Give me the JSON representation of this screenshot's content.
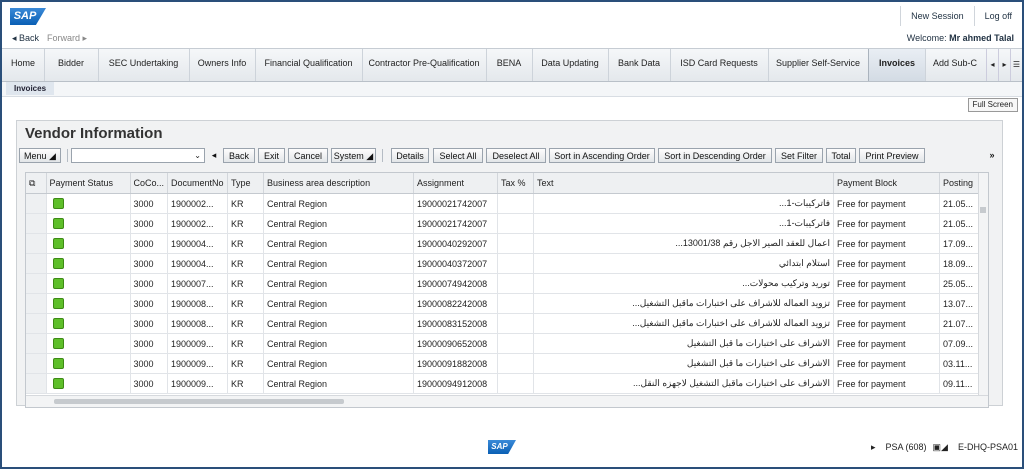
{
  "header": {
    "logo": "SAP",
    "new_session": "New Session",
    "log_off": "Log off"
  },
  "nav": {
    "back": "◂ Back",
    "forward": "Forward ▸",
    "welcome": "Welcome:",
    "user": "Mr ahmed Talal"
  },
  "tabs": [
    "Home",
    "Bidder",
    "SEC Undertaking",
    "Owners Info",
    "Financial Qualification",
    "Contractor Pre-Qualification",
    "BENA",
    "Data Updating",
    "Bank Data",
    "ISD Card Requests",
    "Supplier Self-Service",
    "Invoices",
    "Add Sub-C"
  ],
  "subtab": "Invoices",
  "full_screen": "Full Screen",
  "panel_title": "Vendor Information",
  "toolbar": {
    "menu": "Menu",
    "back": "Back",
    "exit": "Exit",
    "cancel": "Cancel",
    "system": "System",
    "details": "Details",
    "select_all": "Select All",
    "deselect_all": "Deselect All",
    "sort_asc": "Sort in Ascending Order",
    "sort_desc": "Sort in Descending Order",
    "set_filter": "Set Filter",
    "total": "Total",
    "print_preview": "Print Preview",
    "more": "»"
  },
  "table": {
    "columns": [
      "Payment Status",
      "CoCo...",
      "DocumentNo",
      "Type",
      "Business area description",
      "Assignment",
      "Tax %",
      "Text",
      "Payment Block",
      "Posting"
    ],
    "rows": [
      [
        "",
        "3000",
        "1900002...",
        "KR",
        "Central Region",
        "19000021742007",
        "",
        "فاتركيبات-1...",
        "Free for payment",
        "21.05..."
      ],
      [
        "",
        "3000",
        "1900002...",
        "KR",
        "Central Region",
        "19000021742007",
        "",
        "فاتركيبات-1...",
        "Free for payment",
        "21.05..."
      ],
      [
        "",
        "3000",
        "1900004...",
        "KR",
        "Central Region",
        "19000040292007",
        "",
        "اعمال للعقد الصير الاجل رقم 13001/38...",
        "Free for payment",
        "17.09..."
      ],
      [
        "",
        "3000",
        "1900004...",
        "KR",
        "Central Region",
        "19000040372007",
        "",
        "استلام ابتدائي",
        "Free for payment",
        "18.09..."
      ],
      [
        "",
        "3000",
        "1900007...",
        "KR",
        "Central Region",
        "19000074942008",
        "",
        "توريد وتركيب محولات...",
        "Free for payment",
        "25.05..."
      ],
      [
        "",
        "3000",
        "1900008...",
        "KR",
        "Central Region",
        "19000082242008",
        "",
        "تزويد العماله للاشراف على اختبارات ماقبل التشغيل...",
        "Free for payment",
        "13.07..."
      ],
      [
        "",
        "3000",
        "1900008...",
        "KR",
        "Central Region",
        "19000083152008",
        "",
        "تزويد العماله للاشراف على اختبارات ماقبل التشغيل...",
        "Free for payment",
        "21.07..."
      ],
      [
        "",
        "3000",
        "1900009...",
        "KR",
        "Central Region",
        "19000090652008",
        "",
        "الاشراف على اختبارات ما قبل التشغيل",
        "Free for payment",
        "07.09..."
      ],
      [
        "",
        "3000",
        "1900009...",
        "KR",
        "Central Region",
        "19000091882008",
        "",
        "الاشراف على اختبارات ما قبل التشغيل",
        "Free for payment",
        "03.11..."
      ],
      [
        "",
        "3000",
        "1900009...",
        "KR",
        "Central Region",
        "19000094912008",
        "",
        "الاشراف على اختبارات ماقبل التشغيل لاجهزه النقل...",
        "Free for payment",
        "09.11..."
      ]
    ]
  },
  "status": {
    "system": "PSA (608)",
    "server": "E-DHQ-PSA01"
  },
  "colors": {
    "accent": "#0a5fb4",
    "led": "#5fbf2a",
    "border": "#2a4f7a"
  }
}
